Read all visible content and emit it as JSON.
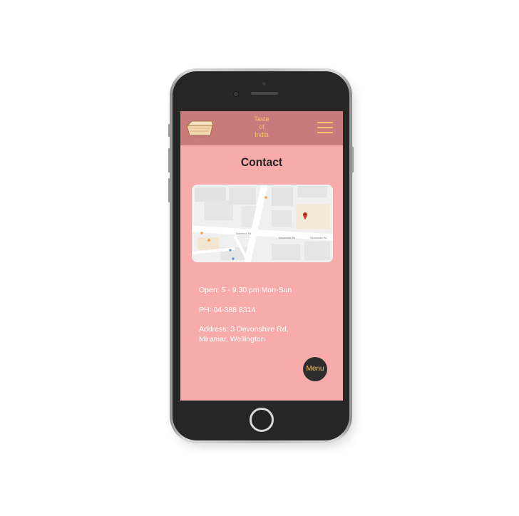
{
  "header": {
    "logo_icon": "takeaway-container-icon",
    "brand_line1": "Taste",
    "brand_line2": "of",
    "brand_line3": "India",
    "menu_icon": "hamburger-icon",
    "background_color": "#c97b7c",
    "accent_color": "#f4c36a"
  },
  "page": {
    "title": "Contact",
    "background_color": "#f7acab"
  },
  "map": {
    "icon": "map-pin-icon"
  },
  "contact": {
    "hours": "Open: 5 - 9.30 pm Mon-Sun",
    "phone": "PH: 04-388 8314",
    "address_line1": "Address: 3 Devonshire Rd,",
    "address_line2": "Miramar, Wellington"
  },
  "fab": {
    "label": "Menu"
  }
}
